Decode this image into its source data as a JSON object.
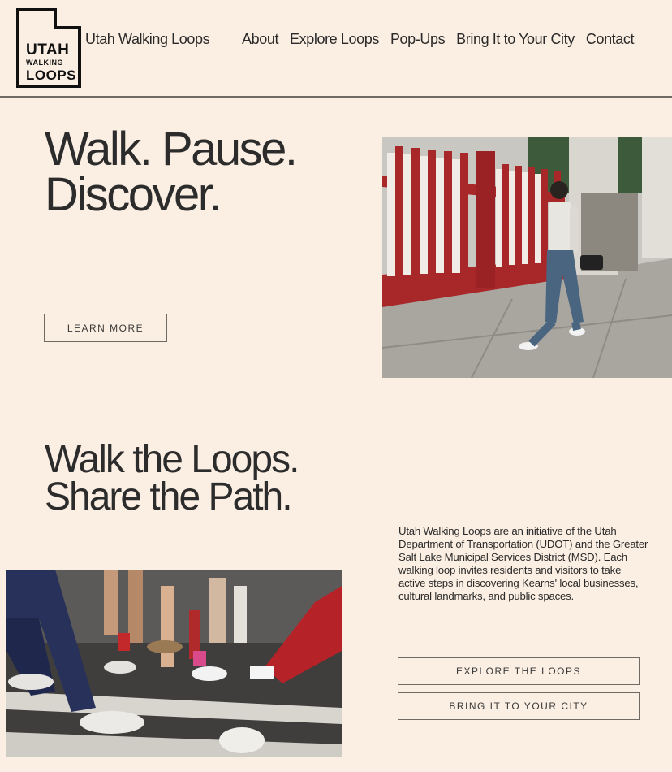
{
  "logo": {
    "line1": "UTAH",
    "line2": "WALKING",
    "line3": "LOOPS"
  },
  "header": {
    "site_name": "Utah Walking Loops",
    "nav": [
      "About",
      "Explore Loops",
      "Pop-Ups",
      "Bring It to Your City",
      "Contact"
    ]
  },
  "hero": {
    "title_line1": "Walk. Pause.",
    "title_line2": "Discover.",
    "learn_more": "LEARN MORE"
  },
  "section": {
    "title_line1": "Walk the Loops.",
    "title_line2": "Share the Path.",
    "description": "Utah Walking Loops are an initiative of the Utah Department of Transportation (UDOT) and the Greater Salt Lake Municipal Services District (MSD). Each walking loop invites residents and visitors to take active steps in discovering Kearns' local businesses, cultural landmarks, and public spaces.",
    "explore_button": "EXPLORE THE LOOPS",
    "bring_button": "BRING IT TO YOUR CITY"
  },
  "colors": {
    "background": "#fbeee2",
    "text": "#2a2a2a",
    "border": "#6f6a63",
    "fence_red": "#a8282a"
  }
}
